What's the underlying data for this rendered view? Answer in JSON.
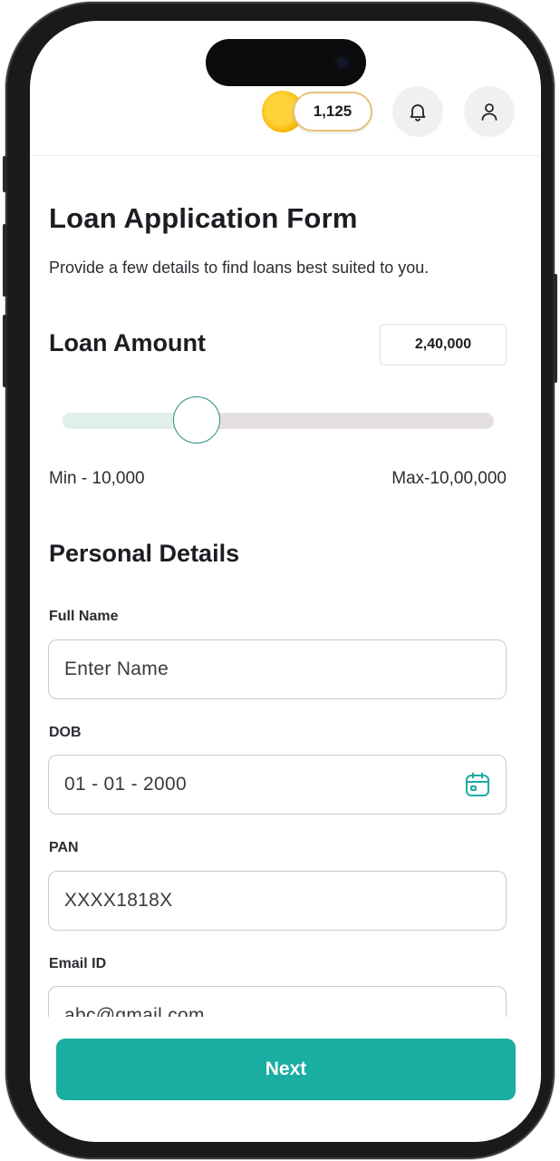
{
  "header": {
    "coin_count": "1,125",
    "coin_icon": "coin-icon",
    "notification_icon": "bell-icon",
    "profile_icon": "user-icon"
  },
  "form": {
    "title": "Loan Application Form",
    "subtitle": "Provide a few details to find loans best suited to you."
  },
  "loan_amount": {
    "heading": "Loan Amount",
    "value": "2,40,000",
    "slider_fraction": 0.31,
    "min_label": "Min - 10,000",
    "max_label": "Max-10,00,000"
  },
  "personal_details": {
    "heading": "Personal Details",
    "fields": [
      {
        "label": "Full Name",
        "value": "",
        "placeholder": "Enter Name"
      },
      {
        "label": "DOB",
        "value": "01 - 01 - 2000",
        "icon": "calendar-icon"
      },
      {
        "label": "PAN",
        "value": "XXXX1818X"
      },
      {
        "label": "Email ID",
        "value": "abc@gmail.com"
      }
    ]
  },
  "actions": {
    "next_label": "Next"
  },
  "colors": {
    "accent": "#1aada1",
    "slider_fill": "#e1efe9",
    "slider_track": "#e6dfdf",
    "coin": "#f5b400"
  }
}
